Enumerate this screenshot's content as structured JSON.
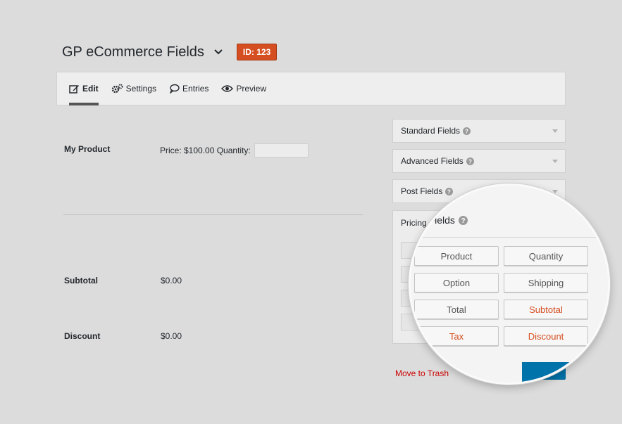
{
  "header": {
    "title": "GP eCommerce Fields",
    "id_badge": "ID: 123"
  },
  "tabs": [
    {
      "label": "Edit",
      "icon": "edit-icon",
      "active": true
    },
    {
      "label": "Settings",
      "icon": "gears-icon",
      "active": false
    },
    {
      "label": "Entries",
      "icon": "speech-bubble-icon",
      "active": false
    },
    {
      "label": "Preview",
      "icon": "eye-icon",
      "active": false
    }
  ],
  "form": {
    "product": {
      "label": "My Product",
      "price_text": "Price: $100.00 Quantity:",
      "quantity_value": ""
    },
    "subtotal": {
      "label": "Subtotal",
      "value": "$0.00"
    },
    "discount": {
      "label": "Discount",
      "value": "$0.00"
    }
  },
  "sidebar": {
    "panels": [
      {
        "label": "Standard Fields"
      },
      {
        "label": "Advanced Fields"
      },
      {
        "label": "Post Fields"
      }
    ],
    "pricing": {
      "label": "Pricing Fields",
      "visible_label": "Pricing"
    },
    "trash_label": "Move to Trash"
  },
  "magnifier": {
    "heading_prefix": "Pricing",
    "heading": "ing Fields",
    "buttons": [
      {
        "label": "Product",
        "color": "#555555"
      },
      {
        "label": "Quantity",
        "color": "#555555"
      },
      {
        "label": "Option",
        "color": "#555555"
      },
      {
        "label": "Shipping",
        "color": "#555555"
      },
      {
        "label": "Total",
        "color": "#555555"
      },
      {
        "label": "Subtotal",
        "color": "#d54e21"
      },
      {
        "label": "Tax",
        "color": "#d54e21"
      },
      {
        "label": "Discount",
        "color": "#d54e21"
      }
    ]
  },
  "colors": {
    "badge": "#d54e21",
    "accent_red": "#d54e21",
    "trash_red": "#cc0000",
    "update_blue": "#0073aa"
  }
}
